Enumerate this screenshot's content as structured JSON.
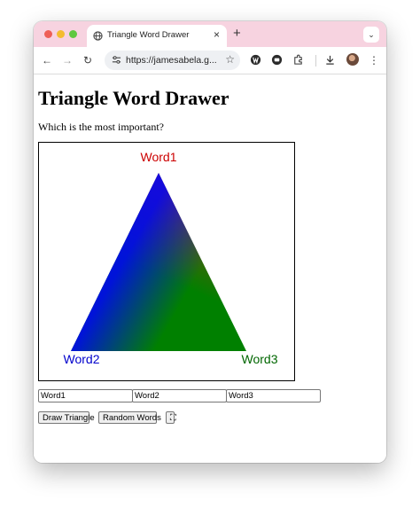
{
  "browser": {
    "tab_title": "Triangle Word Drawer",
    "url": "https://jamesabela.g...",
    "icons": [
      "back-icon",
      "forward-icon",
      "reload-icon",
      "site-info-icon",
      "star-icon",
      "extension-icon",
      "download-icon",
      "menu-icon"
    ]
  },
  "page": {
    "heading": "Triangle Word Drawer",
    "question": "Which is the most important?"
  },
  "triangle": {
    "labels": [
      {
        "text": "Word1",
        "color": "#cc0000"
      },
      {
        "text": "Word2",
        "color": "#0000cc"
      },
      {
        "text": "Word3",
        "color": "#006600"
      }
    ],
    "fill_colors": [
      "#8b4513",
      "#008000",
      "#0000ff"
    ]
  },
  "inputs": {
    "word1": "Word1",
    "word2": "Word2",
    "word3": "Word3"
  },
  "buttons": {
    "draw": "Draw Triangle",
    "random": "Random Words",
    "fullscreen": "⛶"
  },
  "colors": {
    "titlebar": "#f7d3e0"
  }
}
